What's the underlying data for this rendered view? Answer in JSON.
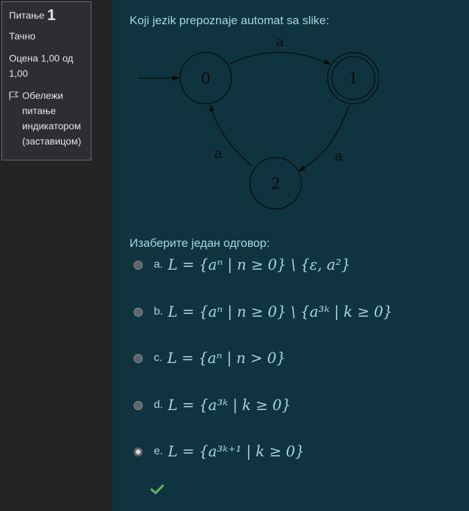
{
  "sidebar": {
    "question_label": "Питање",
    "question_number": "1",
    "status": "Тачно",
    "grade": "Оцена 1,00 од 1,00",
    "flag_label": "Обележи питање индикатором (заставицом)"
  },
  "question": {
    "text": "Koji jezik prepoznaje automat sa slike:",
    "diagram": {
      "states": [
        "0",
        "1",
        "2"
      ],
      "transition_labels": [
        "a",
        "a",
        "a"
      ]
    },
    "prompt": "Изаберите један одговор:"
  },
  "answers": [
    {
      "letter": "a.",
      "formula": "L = {aⁿ | n ≥ 0} \\ {ε, a²}",
      "selected": false
    },
    {
      "letter": "b.",
      "formula": "L = {aⁿ | n ≥ 0} \\ {a³ᵏ | k ≥ 0}",
      "selected": false
    },
    {
      "letter": "c.",
      "formula": "L = {aⁿ | n > 0}",
      "selected": false
    },
    {
      "letter": "d.",
      "formula": "L = {a³ᵏ | k ≥ 0}",
      "selected": false
    },
    {
      "letter": "e.",
      "formula": "L = {a³ᵏ⁺¹ | k ≥ 0}",
      "selected": true
    }
  ],
  "colors": {
    "main_bg": "#0f3440",
    "sidebar_bg": "#222426",
    "text_accent": "#a9d6e6",
    "correct_check": "#5fb85f"
  }
}
